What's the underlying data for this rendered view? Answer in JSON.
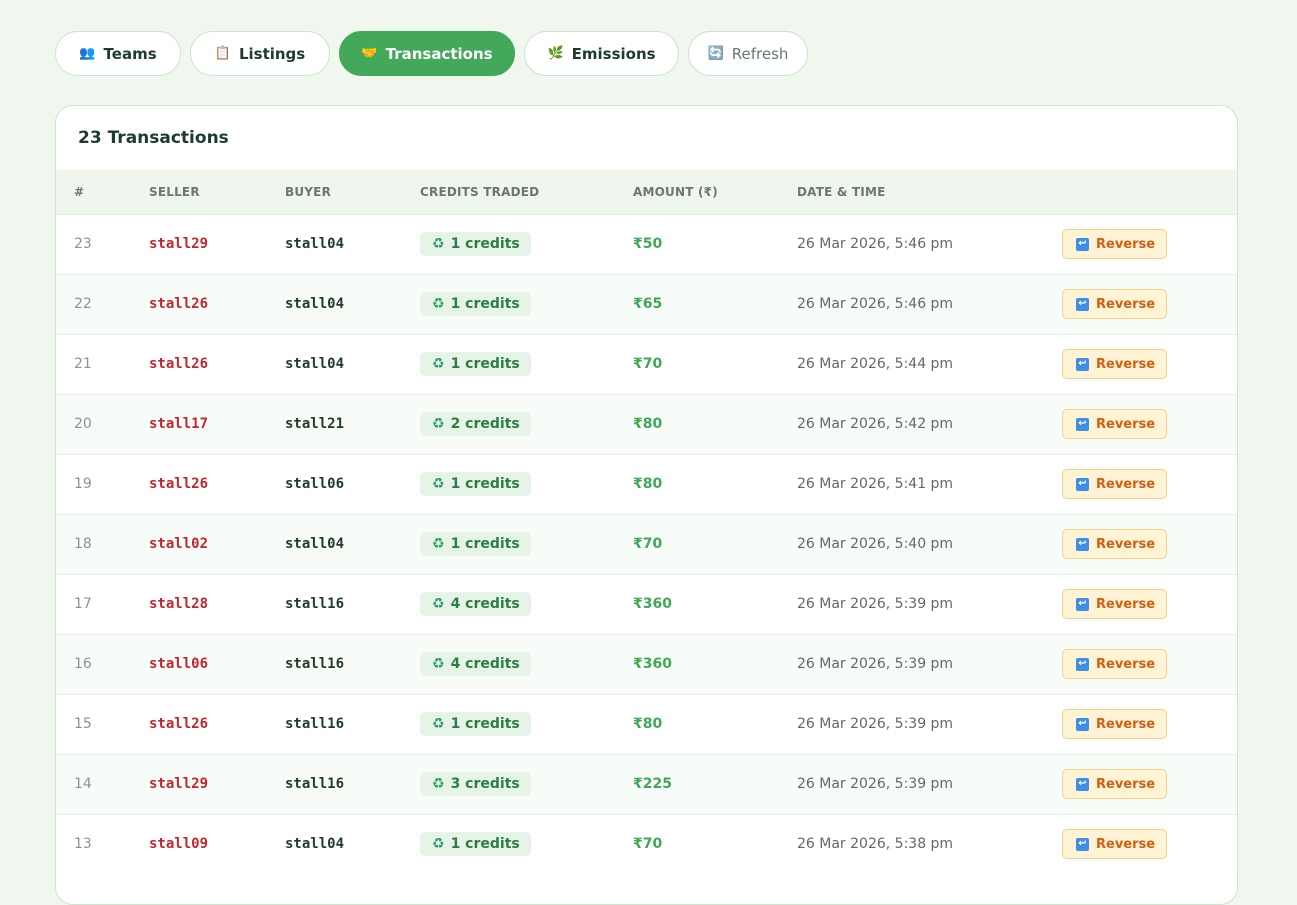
{
  "nav": {
    "tabs": [
      {
        "icon": "👥",
        "label": "Teams"
      },
      {
        "icon": "📋",
        "label": "Listings"
      },
      {
        "icon": "🤝",
        "label": "Transactions"
      },
      {
        "icon": "🌿",
        "label": "Emissions"
      },
      {
        "icon": "🔄",
        "label": "Refresh"
      }
    ],
    "active": "Transactions"
  },
  "card": {
    "title": "23 Transactions"
  },
  "table": {
    "headers": [
      "#",
      "SELLER",
      "BUYER",
      "CREDITS TRADED",
      "AMOUNT (₹)",
      "DATE & TIME",
      ""
    ],
    "credits_icon": "♻",
    "action_icon": "↩",
    "action_label": "Reverse",
    "rows": [
      {
        "num": "23",
        "seller": "stall29",
        "buyer": "stall04",
        "credits": "1 credits",
        "amount": "₹50",
        "date": "26 Mar 2026, 5:46 pm"
      },
      {
        "num": "22",
        "seller": "stall26",
        "buyer": "stall04",
        "credits": "1 credits",
        "amount": "₹65",
        "date": "26 Mar 2026, 5:46 pm"
      },
      {
        "num": "21",
        "seller": "stall26",
        "buyer": "stall04",
        "credits": "1 credits",
        "amount": "₹70",
        "date": "26 Mar 2026, 5:44 pm"
      },
      {
        "num": "20",
        "seller": "stall17",
        "buyer": "stall21",
        "credits": "2 credits",
        "amount": "₹80",
        "date": "26 Mar 2026, 5:42 pm"
      },
      {
        "num": "19",
        "seller": "stall26",
        "buyer": "stall06",
        "credits": "1 credits",
        "amount": "₹80",
        "date": "26 Mar 2026, 5:41 pm"
      },
      {
        "num": "18",
        "seller": "stall02",
        "buyer": "stall04",
        "credits": "1 credits",
        "amount": "₹70",
        "date": "26 Mar 2026, 5:40 pm"
      },
      {
        "num": "17",
        "seller": "stall28",
        "buyer": "stall16",
        "credits": "4 credits",
        "amount": "₹360",
        "date": "26 Mar 2026, 5:39 pm"
      },
      {
        "num": "16",
        "seller": "stall06",
        "buyer": "stall16",
        "credits": "4 credits",
        "amount": "₹360",
        "date": "26 Mar 2026, 5:39 pm"
      },
      {
        "num": "15",
        "seller": "stall26",
        "buyer": "stall16",
        "credits": "1 credits",
        "amount": "₹80",
        "date": "26 Mar 2026, 5:39 pm"
      },
      {
        "num": "14",
        "seller": "stall29",
        "buyer": "stall16",
        "credits": "3 credits",
        "amount": "₹225",
        "date": "26 Mar 2026, 5:39 pm"
      },
      {
        "num": "13",
        "seller": "stall09",
        "buyer": "stall04",
        "credits": "1 credits",
        "amount": "₹70",
        "date": "26 Mar 2026, 5:38 pm"
      }
    ]
  },
  "colors": {
    "accent": "#43a85a",
    "seller": "#c0262d",
    "amount": "#3fa857",
    "reverse": "#d25f12",
    "background": "#f0f7ef"
  }
}
